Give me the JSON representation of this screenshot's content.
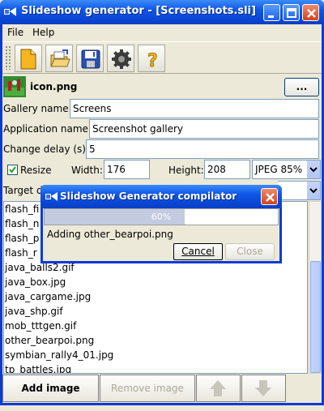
{
  "window": {
    "title": "Slideshow generator - [Screenshots.sli]",
    "buttons": [
      "minimize",
      "maximize",
      "close"
    ]
  },
  "menu": [
    "File",
    "Help"
  ],
  "toolbar": {
    "icons": [
      "new-document-icon",
      "open-folder-icon",
      "save-disk-icon",
      "settings-gear-icon",
      "help-question-icon"
    ]
  },
  "icon_row": {
    "filename": "icon.png",
    "browse_label": "..."
  },
  "form": {
    "gallery_label": "Gallery name:",
    "gallery_value": "Screens",
    "app_label": "Application name:",
    "app_value": "Screenshot gallery",
    "delay_label": "Change delay (s):",
    "delay_value": "5",
    "resize_label": "Resize",
    "resize_checked": true,
    "width_label": "Width:",
    "width_value": "176",
    "height_label": "Height:",
    "height_value": "208",
    "format_value": "JPEG 85%",
    "target_label": "Target d"
  },
  "files": [
    "flash_fi",
    "flash_n",
    "flash_p",
    "flash_r",
    "java_balls2.gif",
    "java_box.jpg",
    "java_cargame.jpg",
    "java_shp.gif",
    "mob_tttgen.gif",
    "other_bearpoi.png",
    "symbian_rally4_01.jpg",
    "tp_battles.jpg"
  ],
  "buttons": {
    "add": "Add image",
    "remove": "Remove image",
    "move_up_icon": "arrow-up-icon",
    "move_down_icon": "arrow-down-icon"
  },
  "dialog": {
    "title": "Slideshow Generator compilator",
    "progress": 0.6,
    "progress_text": "60%",
    "status": "Adding other_bearpoi.png",
    "cancel": "Cancel",
    "close": "Close"
  },
  "colors": {
    "titlebar": "#0a45d3",
    "close_button": "#d5421c",
    "progress_fill": "#c2cbe0"
  }
}
